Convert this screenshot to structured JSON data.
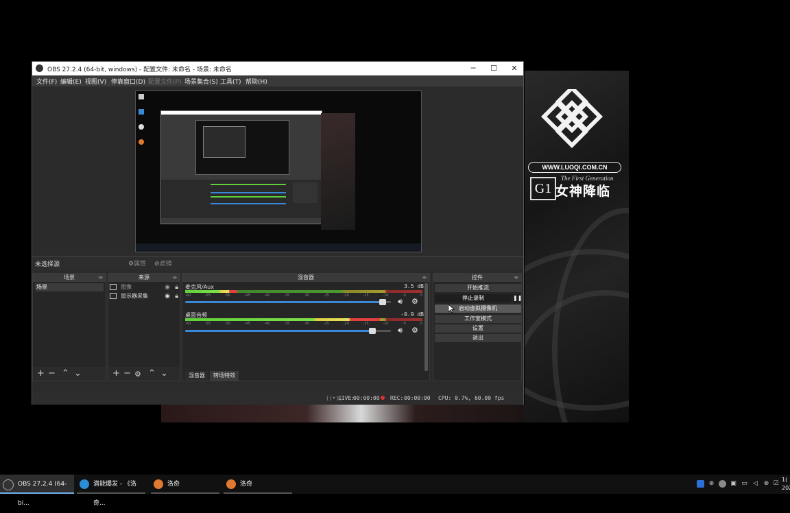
{
  "window": {
    "title": "OBS 27.2.4 (64-bit, windows) - 配置文件: 未命名 - 场景: 未命名",
    "minimize": "─",
    "maximize": "☐",
    "close": "✕"
  },
  "menu": [
    "文件(F)",
    "编辑(E)",
    "视图(V)",
    "停靠窗口(D)",
    "配置文件(P)",
    "场景集合(S)",
    "工具(T)",
    "帮助(H)"
  ],
  "source_toolbar": {
    "no_source": "未选择源",
    "properties": "属性",
    "filters": "滤镜"
  },
  "docks": {
    "scenes": {
      "title": "场景",
      "items": [
        "场景"
      ]
    },
    "sources": {
      "title": "来源",
      "items": [
        {
          "name": "图像",
          "icon": "image-icon",
          "visible": true,
          "locked": true
        },
        {
          "name": "显示器采集",
          "icon": "monitor-icon",
          "visible": true,
          "locked": true
        }
      ]
    },
    "mixer": {
      "title": "混音器",
      "tabs": [
        "混音器",
        "转场特效"
      ],
      "ticks": [
        "-60",
        "-55",
        "-50",
        "-45",
        "-40",
        "-35",
        "-30",
        "-25",
        "-20",
        "-15",
        "-10",
        "-5",
        "0"
      ],
      "tracks": [
        {
          "name": "麦克风/Aux",
          "db": "3.5 dB",
          "level": 0.22,
          "volume": 0.97
        },
        {
          "name": "桌面音频",
          "db": "-0.9 dB",
          "level": 0.82,
          "volume": 0.92
        }
      ]
    },
    "controls": {
      "title": "控件",
      "buttons": [
        "开始推流",
        "停止录制",
        "启动虚拟摄像机",
        "工作室模式",
        "设置",
        "退出"
      ],
      "pause": "❚❚"
    }
  },
  "status": {
    "live_label": "LIVE:",
    "live_time": "00:00:00",
    "rec_label": "REC:",
    "rec_time": "00:00:00",
    "cpu": "CPU: 0.7%, 60.00 fps"
  },
  "brand": {
    "url": "WWW.LUOQI.COM.CN",
    "g1": "G1",
    "generation": "The First Generation",
    "cn": "女神降临"
  },
  "taskbar": {
    "items": [
      {
        "label": "OBS 27.2.4 (64-bi...",
        "icon": "obs-icon"
      },
      {
        "label": "潜能爆发 - 《洛奇...",
        "icon": "edge-icon"
      },
      {
        "label": "洛奇",
        "icon": "mabinogi-icon"
      },
      {
        "label": "洛奇",
        "icon": "mabinogi-icon"
      }
    ],
    "clock_top": "1(",
    "clock_bottom": "202"
  },
  "colors": {
    "accent_blue": "#3a88d8",
    "rec_red": "#e03030",
    "meter_green": "#5fd03a",
    "meter_yellow": "#e0d040",
    "meter_red": "#e04040"
  }
}
